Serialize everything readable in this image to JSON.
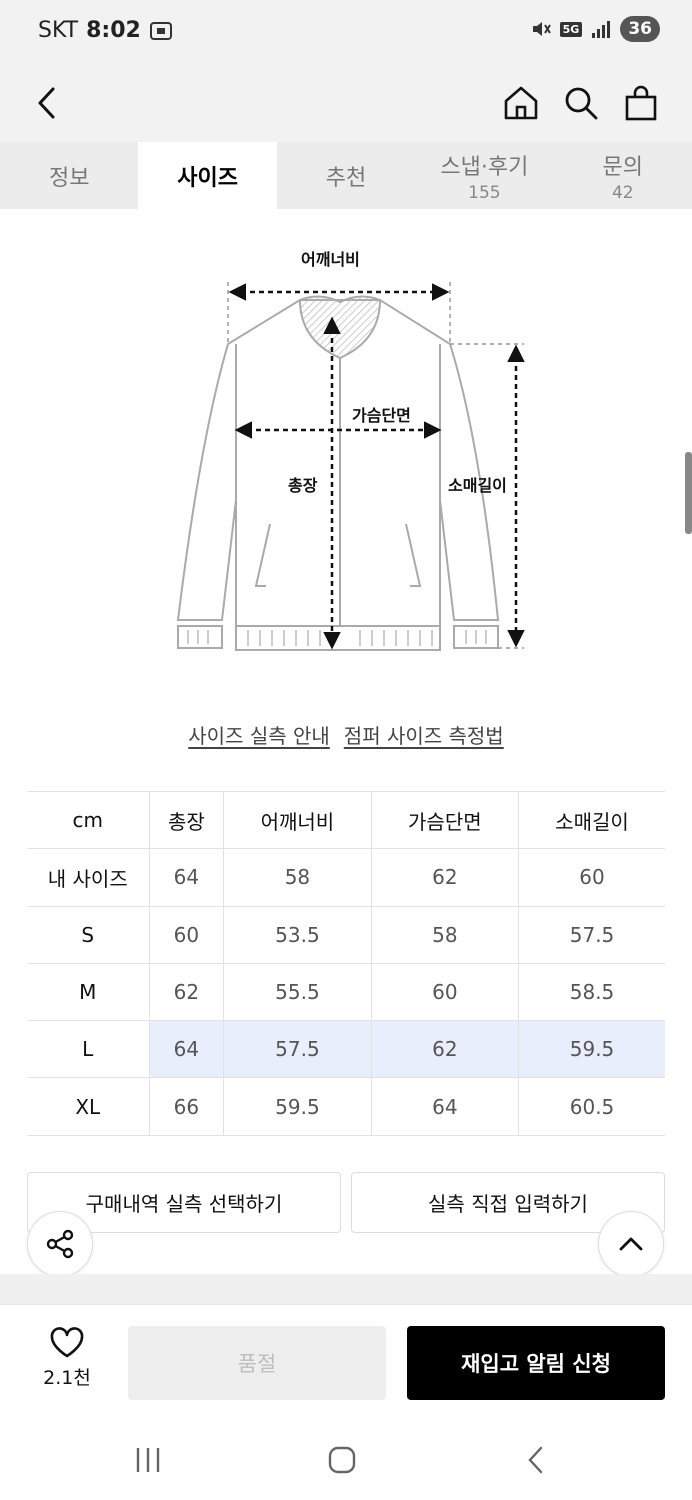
{
  "status_bar": {
    "carrier": "SKT",
    "time": "8:02",
    "network": "5G",
    "battery": "36"
  },
  "tabs": [
    {
      "label": "정보",
      "count": ""
    },
    {
      "label": "사이즈",
      "count": ""
    },
    {
      "label": "추천",
      "count": ""
    },
    {
      "label": "스냅·후기",
      "count": "155"
    },
    {
      "label": "문의",
      "count": "42"
    }
  ],
  "active_tab": "사이즈",
  "diagram": {
    "shoulder": "어깨너비",
    "chest": "가슴단면",
    "length": "총장",
    "sleeve": "소매길이"
  },
  "guide_links": {
    "measure_guide": "사이즈 실측 안내",
    "jumper_guide": "점퍼 사이즈 측정법"
  },
  "size_table": {
    "headers": [
      "cm",
      "총장",
      "어깨너비",
      "가슴단면",
      "소매길이"
    ],
    "rows": [
      {
        "size": "내 사이즈",
        "values": [
          "64",
          "58",
          "62",
          "60"
        ]
      },
      {
        "size": "S",
        "values": [
          "60",
          "53.5",
          "58",
          "57.5"
        ]
      },
      {
        "size": "M",
        "values": [
          "62",
          "55.5",
          "60",
          "58.5"
        ]
      },
      {
        "size": "L",
        "values": [
          "64",
          "57.5",
          "62",
          "59.5"
        ]
      },
      {
        "size": "XL",
        "values": [
          "66",
          "59.5",
          "64",
          "60.5"
        ]
      }
    ],
    "highlighted_size": "L",
    "highlight_color": "#e8eefc"
  },
  "actions": {
    "select_purchase": "구매내역 실측 선택하기",
    "manual_input": "실측 직접 입력하기"
  },
  "bottom_bar": {
    "like_count": "2.1천",
    "soldout_label": "품절",
    "restock_label": "재입고 알림 신청"
  },
  "icons": [
    "back-icon",
    "home-icon",
    "search-icon",
    "bag-icon",
    "share-icon",
    "chevron-up-icon",
    "heart-icon"
  ]
}
